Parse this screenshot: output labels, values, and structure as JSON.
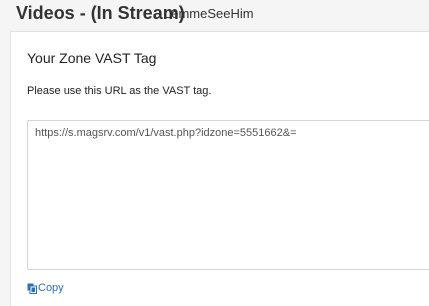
{
  "header": {
    "title": "Videos - (In Stream)",
    "subtitle": "LemmeSeeHim"
  },
  "card": {
    "title": "Your Zone VAST Tag",
    "description": "Please use this URL as the VAST tag.",
    "vast_url": "https://s.magsrv.com/v1/vast.php?idzone=5551662&=",
    "copy_label": "Copy",
    "copy_icon": "copy-icon"
  },
  "colors": {
    "link": "#2a6fb8",
    "background": "#f5f5f5",
    "card": "#ffffff"
  }
}
